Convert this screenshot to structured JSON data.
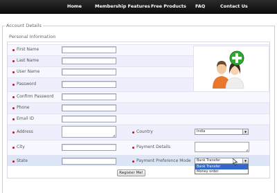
{
  "nav": {
    "items": [
      "Home",
      "Membership Features",
      "Free Products",
      "FAQ",
      "Contact Us"
    ]
  },
  "fieldset": {
    "legend": "Account Details",
    "section_title": "Personal Information"
  },
  "form": {
    "first_name_label": "First Name",
    "last_name_label": "Last Name",
    "user_name_label": "User Name",
    "password_label": "Password",
    "confirm_password_label": "Confirm Password",
    "phone_label": "Phone",
    "email_label": "Email ID",
    "address_label": "Address",
    "city_label": "City",
    "state_label": "State",
    "country_label": "Country",
    "country_value": "India",
    "payment_details_label": "Payment Details",
    "payment_pref_label": "Payment Preference Mode",
    "payment_pref_value": "Bank Transfer",
    "payment_options": [
      "Bank Transfer",
      "Money order"
    ],
    "register_label": "Register Me!"
  },
  "icons": {
    "required_marker": "red-bullet",
    "users_add": "users-add-icon",
    "cursor": "mouse-pointer"
  },
  "colors": {
    "nav_bg": "#1a1a1a",
    "required": "#c0121f",
    "selected_option": "#3468c8",
    "add_icon_green": "#2fa82f"
  }
}
